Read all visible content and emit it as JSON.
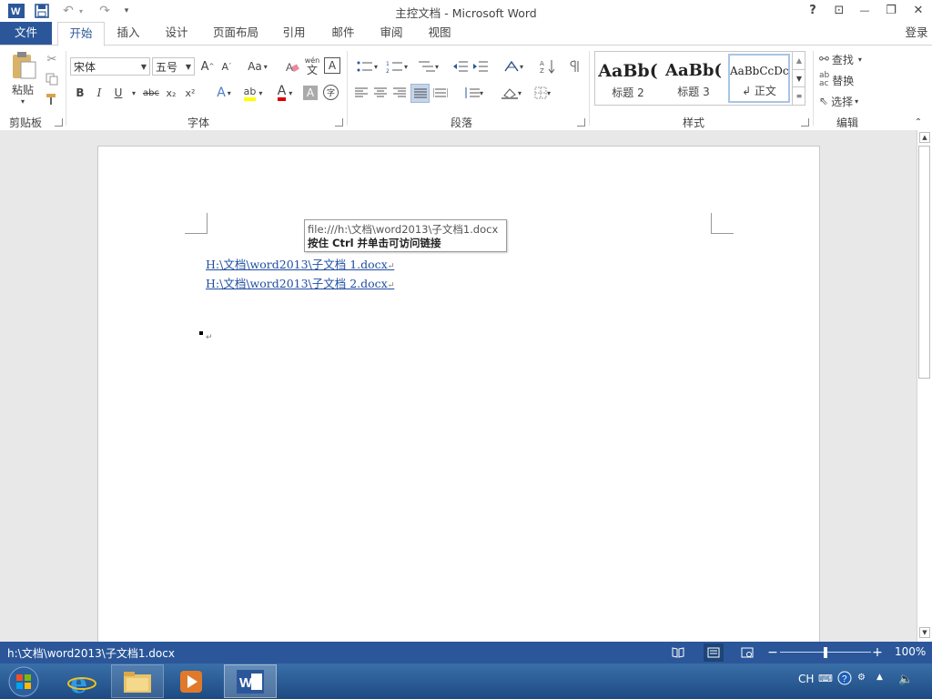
{
  "window": {
    "title": "主控文档 - Microsoft Word",
    "controls": {
      "help": "?",
      "ribbon_display": "⊡",
      "minimize": "—",
      "restore": "❐",
      "close": "✕"
    }
  },
  "qat": {
    "undo": "↶",
    "redo": "↷",
    "customize": "▾"
  },
  "tabs": {
    "file": "文件",
    "items": [
      "开始",
      "插入",
      "设计",
      "页面布局",
      "引用",
      "邮件",
      "审阅",
      "视图"
    ],
    "active": "开始",
    "signin": "登录"
  },
  "ribbon": {
    "clipboard": {
      "label": "剪贴板",
      "paste": "粘贴"
    },
    "font": {
      "label": "字体",
      "font_name": "宋体",
      "font_size": "五号",
      "bold": "B",
      "italic": "I",
      "underline": "U",
      "strike": "abc",
      "subscript": "x₂",
      "superscript": "x²",
      "grow": "A",
      "shrink": "A",
      "case": "Aa",
      "phonetic": "wén",
      "phonetic_char": "文",
      "border_char": "A",
      "text_effect": "A",
      "highlight": "ab",
      "font_color": "A",
      "shading": "A",
      "enclose": "字"
    },
    "paragraph": {
      "label": "段落"
    },
    "styles": {
      "label": "样式",
      "items": [
        {
          "sample": "AaBb(",
          "name": "标题 2"
        },
        {
          "sample": "AaBb(",
          "name": "标题 3"
        },
        {
          "sample": "AaBbCcDc",
          "name": "↲ 正文"
        }
      ]
    },
    "editing": {
      "label": "编辑",
      "find": "查找",
      "replace": "替换",
      "select": "选择"
    }
  },
  "document": {
    "links": [
      {
        "text": "H:\\文档\\word2013\\子文档 1.docx"
      },
      {
        "text": "H:\\文档\\word2013\\子文档 2.docx"
      }
    ],
    "para_mark": "↵",
    "tooltip": {
      "line1": "file:///h:\\文档\\word2013\\子文档1.docx",
      "line2": "按住 Ctrl 并单击可访问链接"
    }
  },
  "statusbar": {
    "path": "h:\\文档\\word2013\\子文档1.docx",
    "zoom": "100%",
    "zoom_level_percent": 100
  },
  "taskbar": {
    "lang": "CH"
  },
  "colors": {
    "accent": "#2b579a",
    "link": "#1f4ea1"
  }
}
